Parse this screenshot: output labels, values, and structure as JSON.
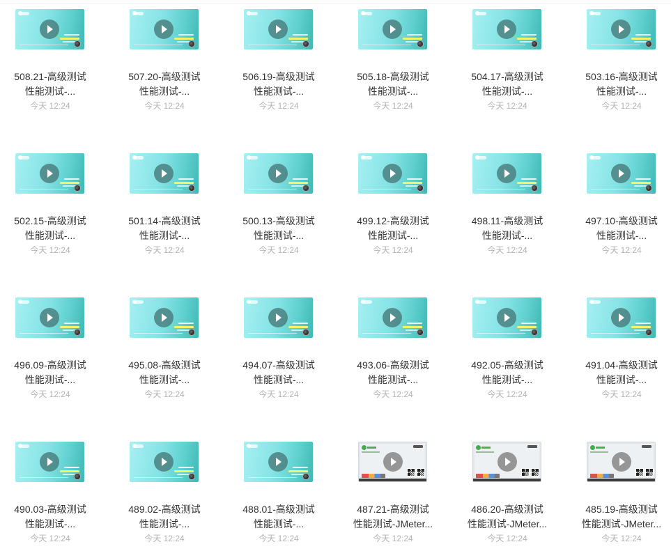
{
  "files": [
    {
      "title_line1": "508.21-高级测试",
      "title_line2": "性能测试-...",
      "time": "今天 12:24",
      "thumb_icon": "course-cover-icon"
    },
    {
      "title_line1": "507.20-高级测试",
      "title_line2": "性能测试-...",
      "time": "今天 12:24",
      "thumb_icon": "course-cover-icon"
    },
    {
      "title_line1": "506.19-高级测试",
      "title_line2": "性能测试-...",
      "time": "今天 12:24",
      "thumb_icon": "course-cover-icon"
    },
    {
      "title_line1": "505.18-高级测试",
      "title_line2": "性能测试-...",
      "time": "今天 12:24",
      "thumb_icon": "course-cover-icon"
    },
    {
      "title_line1": "504.17-高级测试",
      "title_line2": "性能测试-...",
      "time": "今天 12:24",
      "thumb_icon": "course-cover-icon"
    },
    {
      "title_line1": "503.16-高级测试",
      "title_line2": "性能测试-...",
      "time": "今天 12:24",
      "thumb_icon": "course-cover-icon"
    },
    {
      "title_line1": "502.15-高级测试",
      "title_line2": "性能测试-...",
      "time": "今天 12:24",
      "thumb_icon": "course-cover-icon"
    },
    {
      "title_line1": "501.14-高级测试",
      "title_line2": "性能测试-...",
      "time": "今天 12:24",
      "thumb_icon": "course-cover-icon"
    },
    {
      "title_line1": "500.13-高级测试",
      "title_line2": "性能测试-...",
      "time": "今天 12:24",
      "thumb_icon": "course-cover-icon"
    },
    {
      "title_line1": "499.12-高级测试",
      "title_line2": "性能测试-...",
      "time": "今天 12:24",
      "thumb_icon": "course-cover-icon"
    },
    {
      "title_line1": "498.11-高级测试",
      "title_line2": "性能测试-...",
      "time": "今天 12:24",
      "thumb_icon": "course-cover-icon"
    },
    {
      "title_line1": "497.10-高级测试",
      "title_line2": "性能测试-...",
      "time": "今天 12:24",
      "thumb_icon": "course-cover-icon"
    },
    {
      "title_line1": "496.09-高级测试",
      "title_line2": "性能测试-...",
      "time": "今天 12:24",
      "thumb_icon": "course-cover-icon"
    },
    {
      "title_line1": "495.08-高级测试",
      "title_line2": "性能测试-...",
      "time": "今天 12:24",
      "thumb_icon": "course-cover-icon"
    },
    {
      "title_line1": "494.07-高级测试",
      "title_line2": "性能测试-...",
      "time": "今天 12:24",
      "thumb_icon": "course-cover-icon"
    },
    {
      "title_line1": "493.06-高级测试",
      "title_line2": "性能测试-...",
      "time": "今天 12:24",
      "thumb_icon": "course-cover-icon"
    },
    {
      "title_line1": "492.05-高级测试",
      "title_line2": "性能测试-...",
      "time": "今天 12:24",
      "thumb_icon": "course-cover-icon"
    },
    {
      "title_line1": "491.04-高级测试",
      "title_line2": "性能测试-...",
      "time": "今天 12:24",
      "thumb_icon": "course-cover-icon"
    },
    {
      "title_line1": "490.03-高级测试",
      "title_line2": "性能测试-...",
      "time": "今天 12:24",
      "thumb_icon": "course-cover-icon"
    },
    {
      "title_line1": "489.02-高级测试",
      "title_line2": "性能测试-...",
      "time": "今天 12:24",
      "thumb_icon": "course-cover-icon"
    },
    {
      "title_line1": "488.01-高级测试",
      "title_line2": "性能测试-...",
      "time": "今天 12:24",
      "thumb_icon": "course-cover-icon"
    },
    {
      "title_line1": "487.21-高级测试",
      "title_line2": "性能测试-JMeter...",
      "time": "今天 12:24",
      "thumb_icon": "screen-recording-icon"
    },
    {
      "title_line1": "486.20-高级测试",
      "title_line2": "性能测试-JMeter...",
      "time": "今天 12:24",
      "thumb_icon": "screen-recording-icon"
    },
    {
      "title_line1": "485.19-高级测试",
      "title_line2": "性能测试-JMeter...",
      "time": "今天 12:24",
      "thumb_icon": "screen-recording-icon"
    }
  ],
  "colors": {
    "title_text": "#333333",
    "time_text": "#b3b3b3",
    "cover_teal": "#5fd0cf",
    "play_button": "#46787a"
  }
}
